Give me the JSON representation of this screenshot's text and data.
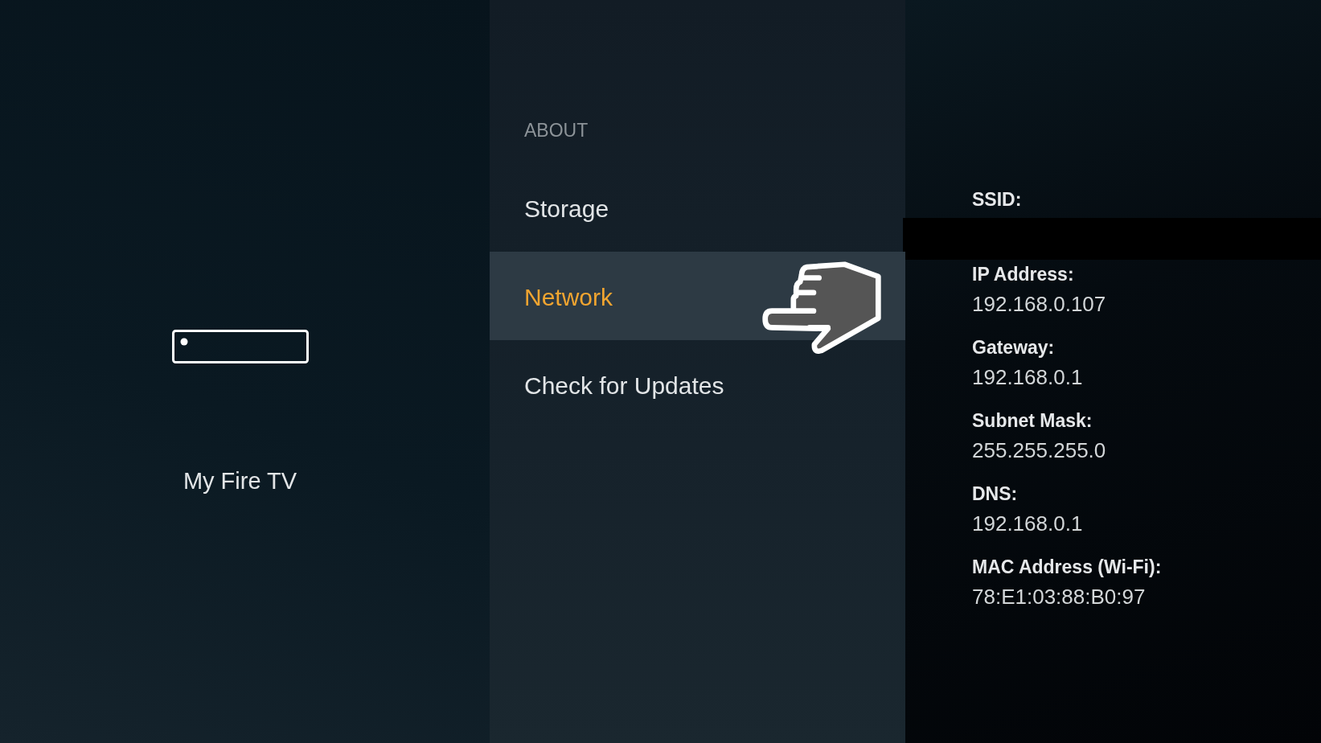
{
  "sidebar": {
    "device_name": "My Fire TV"
  },
  "menu": {
    "heading": "ABOUT",
    "items": [
      {
        "label": "Storage",
        "selected": false
      },
      {
        "label": "Network",
        "selected": true
      },
      {
        "label": "Check for Updates",
        "selected": false
      }
    ]
  },
  "network_details": [
    {
      "label": "SSID:",
      "redacted": true
    },
    {
      "label": "IP Address:",
      "value": "192.168.0.107",
      "redacted": false
    },
    {
      "label": "Gateway:",
      "value": "192.168.0.1",
      "redacted": false
    },
    {
      "label": "Subnet Mask:",
      "value": "255.255.255.0",
      "redacted": false
    },
    {
      "label": "DNS:",
      "value": "192.168.0.1",
      "redacted": false
    },
    {
      "label": "MAC Address (Wi-Fi):",
      "value": "78:E1:03:88:B0:97",
      "redacted": false
    }
  ]
}
